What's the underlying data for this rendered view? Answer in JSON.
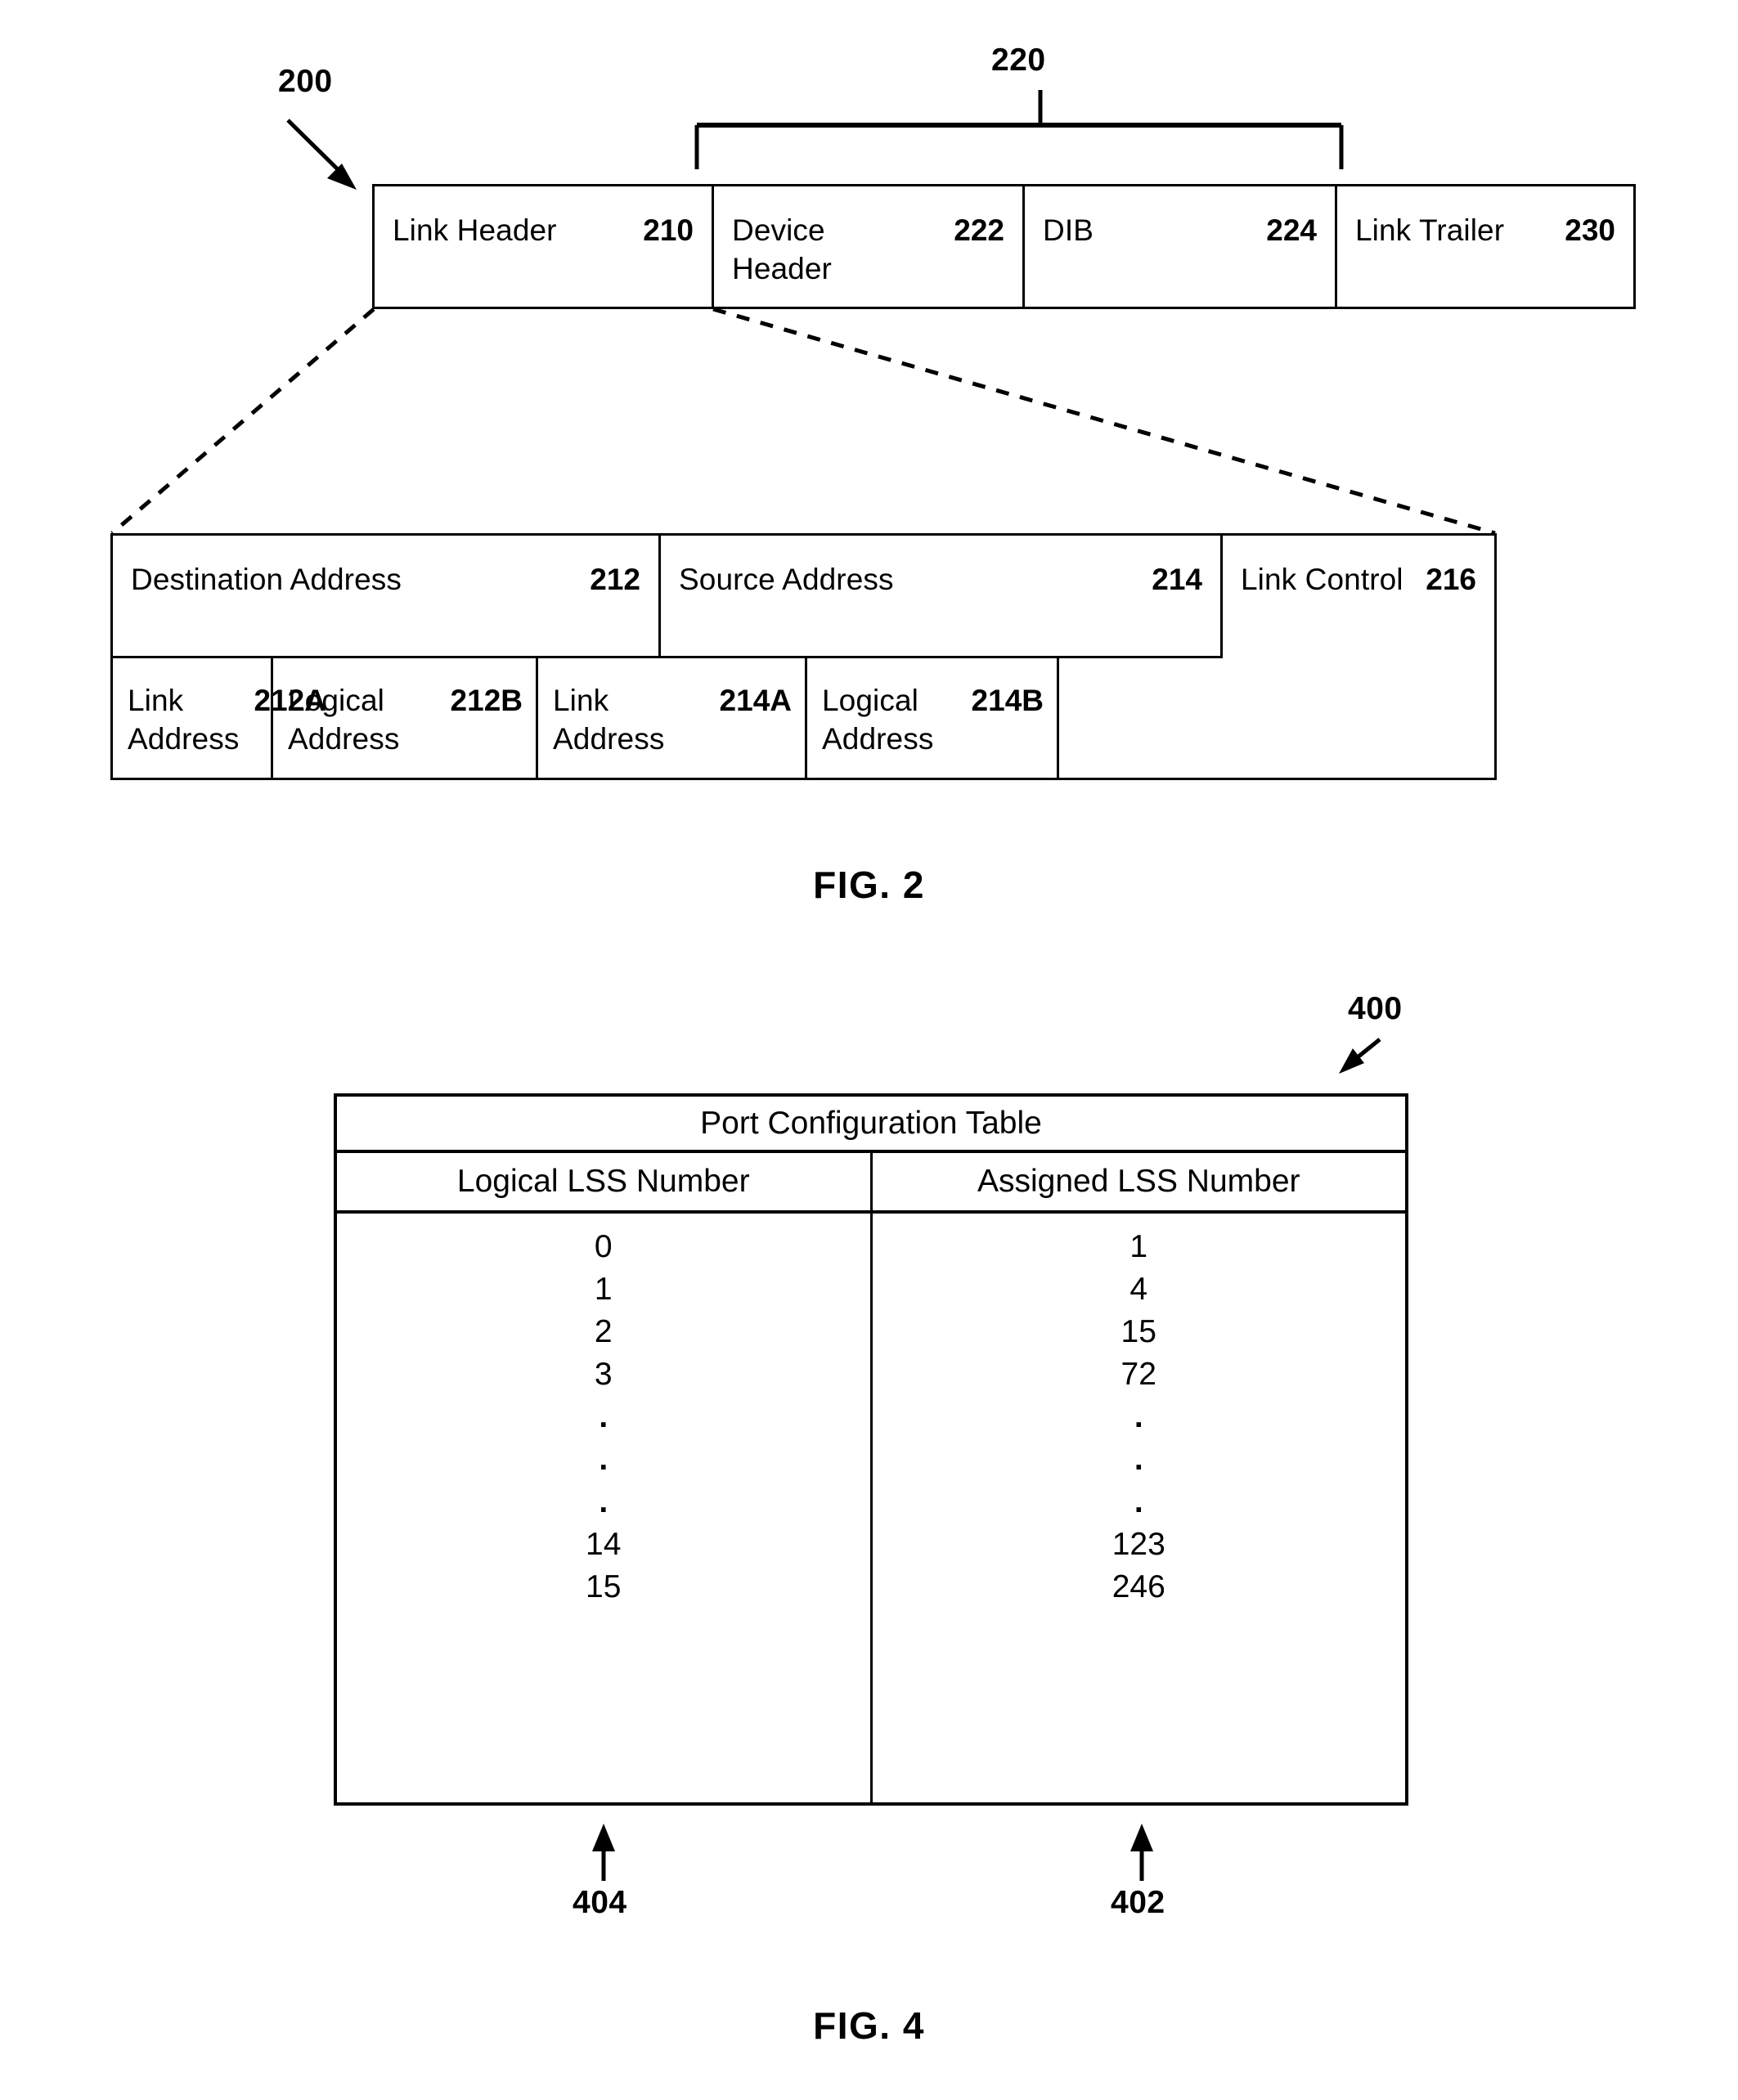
{
  "figure2": {
    "frame_ref": "200",
    "bracket_ref": "220",
    "caption": "FIG. 2",
    "frame_cells": [
      {
        "label": "Link Header",
        "ref": "210"
      },
      {
        "label": "Device\nHeader",
        "ref": "222"
      },
      {
        "label": "DIB",
        "ref": "224"
      },
      {
        "label": "Link Trailer",
        "ref": "230"
      }
    ],
    "detail_top_cells": [
      {
        "label": "Destination Address",
        "ref": "212"
      },
      {
        "label": "Source Address",
        "ref": "214"
      },
      {
        "label": "Link Control",
        "ref": "216"
      }
    ],
    "detail_bottom_cells": [
      {
        "label": "Link\nAddress",
        "ref": "212A"
      },
      {
        "label": "Logical\nAddress",
        "ref": "212B"
      },
      {
        "label": "Link\nAddress",
        "ref": "214A"
      },
      {
        "label": "Logical\nAddress",
        "ref": "214B"
      }
    ]
  },
  "figure4": {
    "table_ref": "400",
    "caption": "FIG. 4",
    "title": "Port Configuration Table",
    "columns": [
      {
        "header": "Logical LSS Number",
        "ref": "404"
      },
      {
        "header": "Assigned LSS Number",
        "ref": "402"
      }
    ],
    "rows": [
      {
        "logical": "0",
        "assigned": "1"
      },
      {
        "logical": "1",
        "assigned": "4"
      },
      {
        "logical": "2",
        "assigned": "15"
      },
      {
        "logical": "3",
        "assigned": "72"
      },
      {
        "logical": ".",
        "assigned": "."
      },
      {
        "logical": ".",
        "assigned": "."
      },
      {
        "logical": ".",
        "assigned": "."
      },
      {
        "logical": "14",
        "assigned": "123"
      },
      {
        "logical": "15",
        "assigned": "246"
      }
    ]
  }
}
